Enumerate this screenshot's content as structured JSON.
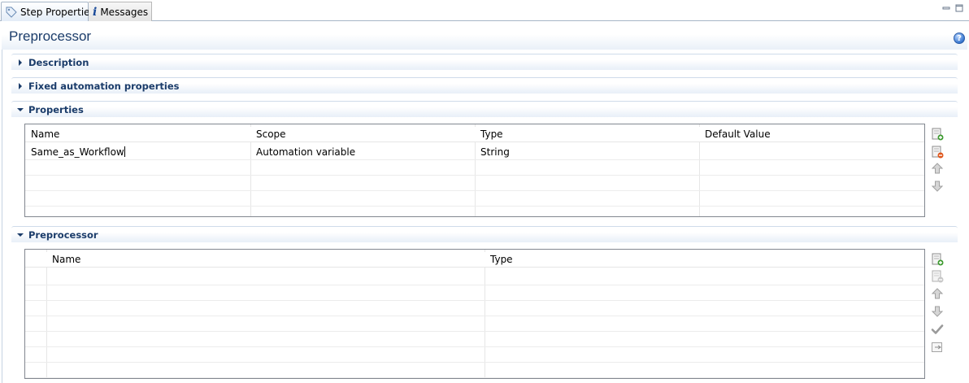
{
  "tabs": [
    {
      "label": "Step Properties",
      "icon": "tag-icon",
      "active": true
    },
    {
      "label": "Messages",
      "icon": "info-icon",
      "active": false
    }
  ],
  "form": {
    "title": "Preprocessor",
    "help_icon": "help-icon"
  },
  "sections": {
    "description": {
      "title": "Description",
      "expanded": false
    },
    "fixed_automation": {
      "title": "Fixed automation properties",
      "expanded": false
    },
    "properties": {
      "title": "Properties",
      "expanded": true
    },
    "preprocessor": {
      "title": "Preprocessor",
      "expanded": true
    }
  },
  "properties_table": {
    "columns": [
      "Name",
      "Scope",
      "Type",
      "Default Value"
    ],
    "rows": [
      [
        "Same_as_Workflow",
        "Automation variable",
        "String",
        ""
      ]
    ],
    "tools": [
      "add-row-icon",
      "remove-row-icon",
      "move-up-icon",
      "move-down-icon"
    ]
  },
  "preprocessor_table": {
    "columns": [
      "",
      "Name",
      "Type"
    ],
    "rows": [],
    "tools": [
      "add-row-icon",
      "remove-row-icon",
      "move-up-icon",
      "move-down-icon",
      "checkmark-icon",
      "export-icon"
    ]
  },
  "colors": {
    "title": "#1b3c6a",
    "border": "#a7b6c7",
    "grid_border": "#828790"
  }
}
